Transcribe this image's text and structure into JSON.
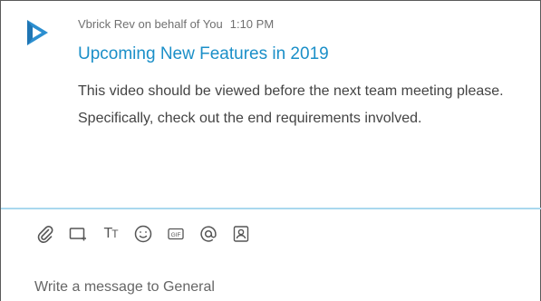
{
  "message": {
    "sender": "Vbrick Rev on behalf of You",
    "time": "1:10 PM",
    "title": "Upcoming New Features in 2019",
    "body": "This video should be viewed before the next team meeting please.  Specifically, check out the end requirements involved."
  },
  "composer": {
    "placeholder": "Write a message to General",
    "tools": [
      "attach-icon",
      "screen-share-icon",
      "format-text-icon",
      "emoji-icon",
      "gif-icon",
      "mention-icon",
      "contact-card-icon"
    ]
  },
  "colors": {
    "accent": "#1b8fc8",
    "divider": "#a9d8ee",
    "logo": "#2c8fd0"
  }
}
